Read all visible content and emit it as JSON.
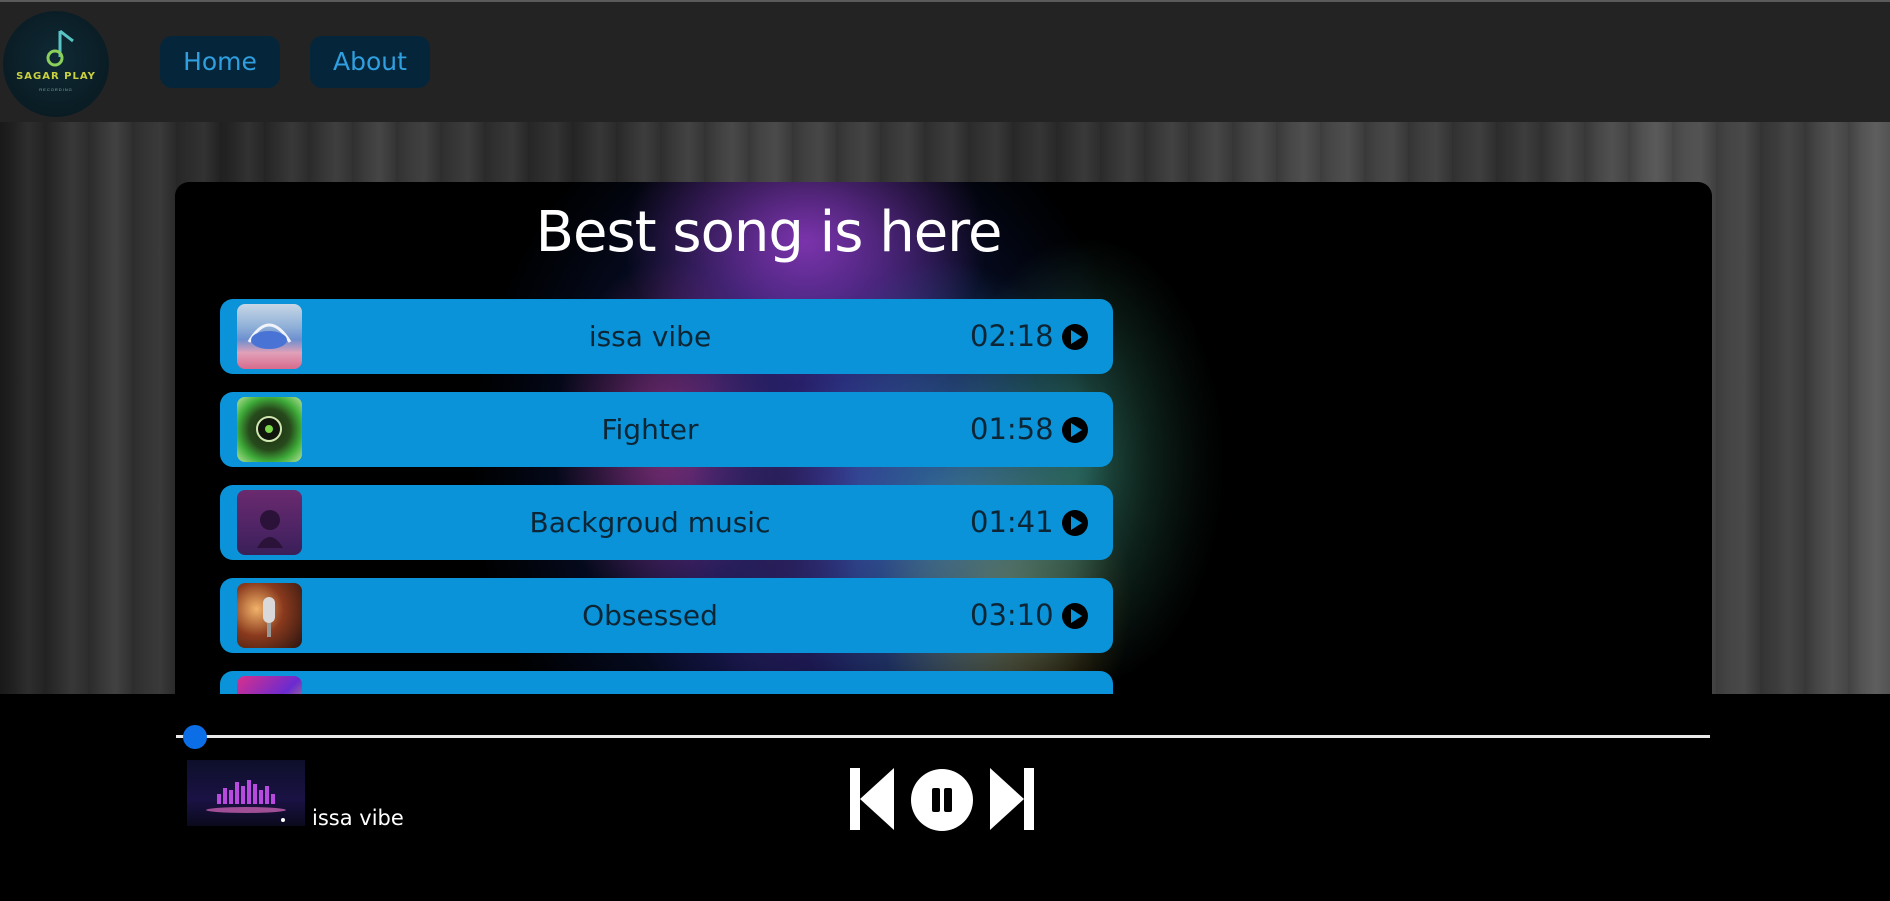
{
  "nav": {
    "logo": {
      "text": "SAGAR PLAY",
      "sub": "RECORDING"
    },
    "items": [
      {
        "label": "Home"
      },
      {
        "label": "About"
      }
    ]
  },
  "main": {
    "title": "Best song is here",
    "songs": [
      {
        "name": "issa vibe",
        "duration": "02:18",
        "icon": "play-circle-icon"
      },
      {
        "name": "Fighter",
        "duration": "01:58",
        "icon": "play-circle-icon"
      },
      {
        "name": "Backgroud music",
        "duration": "01:41",
        "icon": "play-circle-icon"
      },
      {
        "name": "Obsessed",
        "duration": "03:10",
        "icon": "play-circle-icon"
      }
    ]
  },
  "player": {
    "progress": 0.01,
    "now_playing": "issa vibe",
    "controls": [
      "previous-icon",
      "pause-icon",
      "next-icon"
    ]
  },
  "colors": {
    "accent": "#0a93d9",
    "nav_text": "#2f9fe0",
    "nav_button_bg": "#05263a",
    "slider_knob": "#0b6ee6"
  }
}
